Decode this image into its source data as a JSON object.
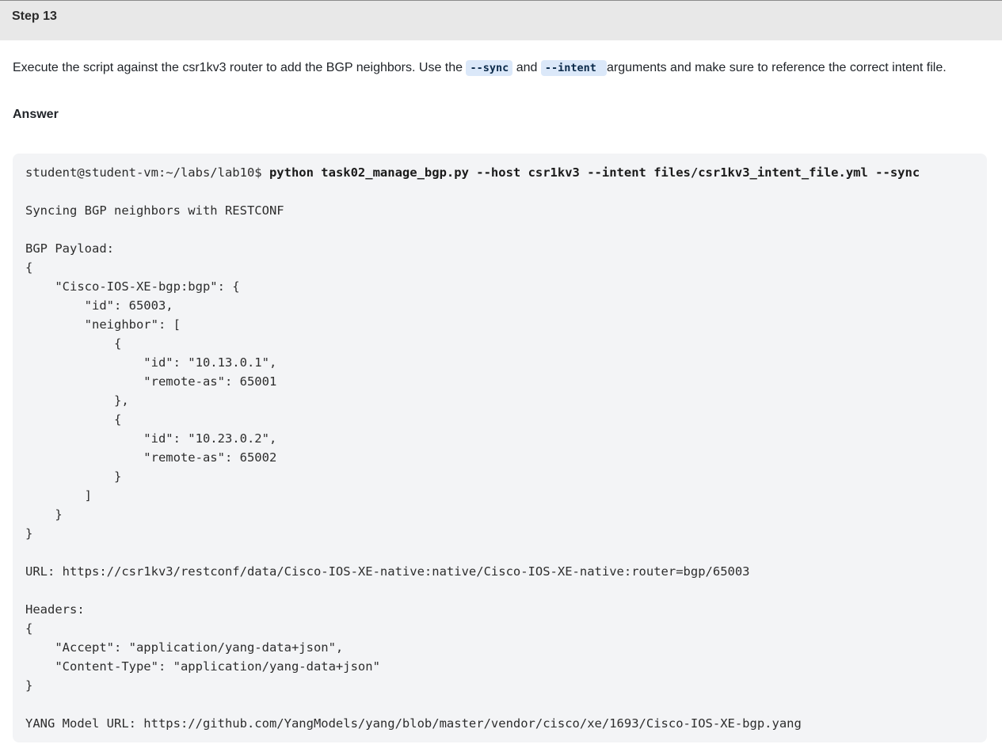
{
  "step": {
    "title": "Step 13"
  },
  "instruction": {
    "text_before": "Execute the script against the csr1kv3 router to add the BGP neighbors. Use the ",
    "code_sync": "--sync",
    "text_and": " and ",
    "code_intent": "--intent ",
    "text_after": " arguments and make sure to reference the correct intent file."
  },
  "answer": {
    "label": "Answer"
  },
  "terminal": {
    "prompt": "student@student-vm:~/labs/lab10$ ",
    "command": "python task02_manage_bgp.py --host csr1kv3 --intent files/csr1kv3_intent_file.yml --sync",
    "output_lines": [
      "",
      "Syncing BGP neighbors with RESTCONF",
      "",
      "BGP Payload:",
      "{",
      "    \"Cisco-IOS-XE-bgp:bgp\": {",
      "        \"id\": 65003,",
      "        \"neighbor\": [",
      "            {",
      "                \"id\": \"10.13.0.1\",",
      "                \"remote-as\": 65001",
      "            },",
      "            {",
      "                \"id\": \"10.23.0.2\",",
      "                \"remote-as\": 65002",
      "            }",
      "        ]",
      "    }",
      "}",
      "",
      "URL: https://csr1kv3/restconf/data/Cisco-IOS-XE-native:native/Cisco-IOS-XE-native:router=bgp/65003",
      "",
      "Headers:",
      "{",
      "    \"Accept\": \"application/yang-data+json\",",
      "    \"Content-Type\": \"application/yang-data+json\"",
      "}",
      "",
      "YANG Model URL: https://github.com/YangModels/yang/blob/master/vendor/cisco/xe/1693/Cisco-IOS-XE-bgp.yang"
    ]
  }
}
